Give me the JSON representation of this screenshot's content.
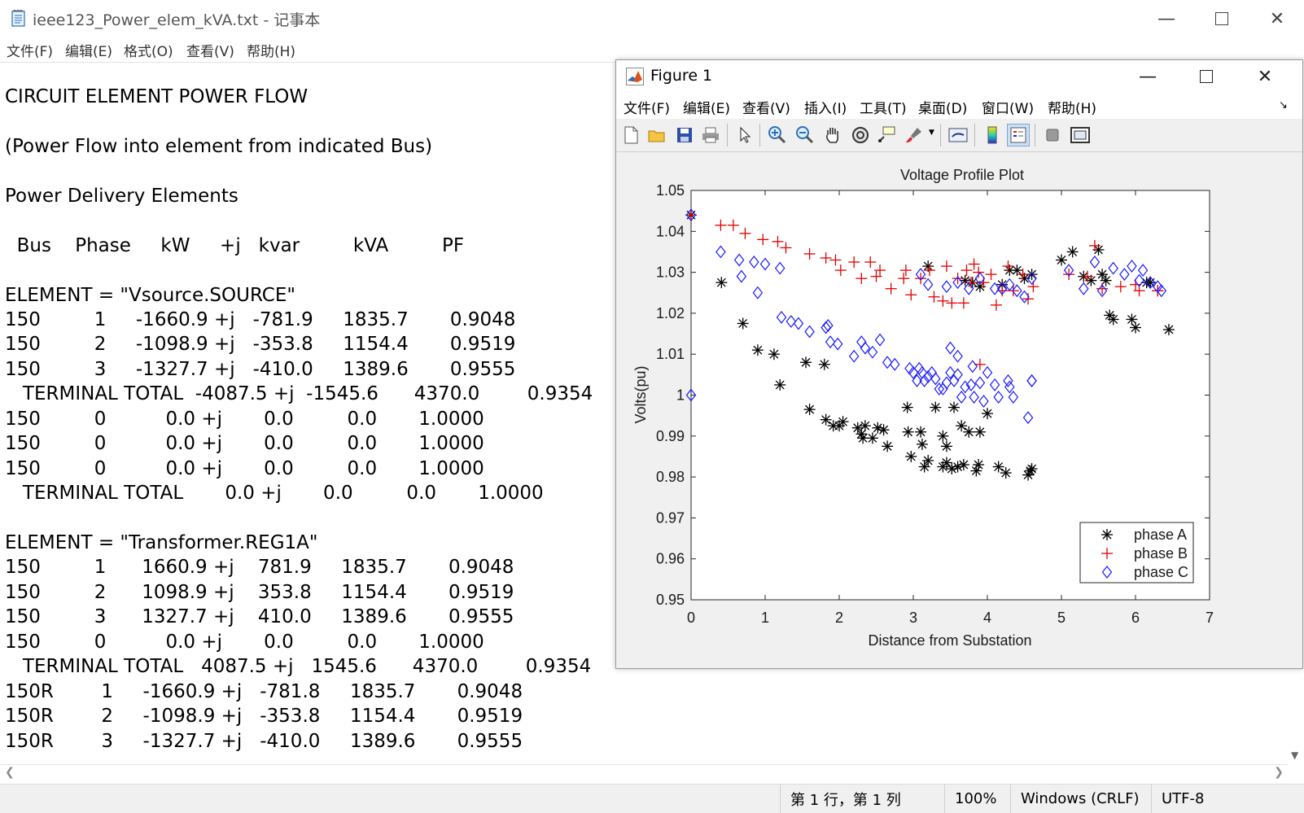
{
  "notepad": {
    "title": "ieee123_Power_elem_kVA.txt - 记事本",
    "menu": [
      "文件(F)",
      "编辑(E)",
      "格式(O)",
      "查看(V)",
      "帮助(H)"
    ],
    "lines": [
      "",
      "CIRCUIT ELEMENT POWER FLOW",
      "",
      "(Power Flow into element from indicated Bus)",
      "",
      "Power Delivery Elements",
      "",
      "  Bus    Phase     kW     +j   kvar         kVA         PF",
      "",
      "ELEMENT = \"Vsource.SOURCE\"",
      "150         1     -1660.9 +j   -781.9     1835.7       0.9048",
      "150         2     -1098.9 +j   -353.8     1154.4       0.9519",
      "150         3     -1327.7 +j   -410.0     1389.6       0.9555",
      "   TERMINAL TOTAL  -4087.5 +j  -1545.6      4370.0        0.9354",
      "150         0          0.0 +j       0.0         0.0       1.0000",
      "150         0          0.0 +j       0.0         0.0       1.0000",
      "150         0          0.0 +j       0.0         0.0       1.0000",
      "   TERMINAL TOTAL       0.0 +j       0.0         0.0       1.0000",
      "",
      "ELEMENT = \"Transformer.REG1A\"",
      "150         1      1660.9 +j    781.9     1835.7       0.9048",
      "150         2      1098.9 +j    353.8     1154.4       0.9519",
      "150         3      1327.7 +j    410.0     1389.6       0.9555",
      "150         0          0.0 +j       0.0         0.0       1.0000",
      "   TERMINAL TOTAL   4087.5 +j   1545.6      4370.0        0.9354",
      "150R        1     -1660.9 +j   -781.8     1835.7       0.9048",
      "150R        2     -1098.9 +j   -353.8     1154.4       0.9519",
      "150R        3     -1327.7 +j   -410.0     1389.6       0.9555"
    ],
    "status": {
      "position": "第 1 行，第 1 列",
      "zoom": "100%",
      "line_ending": "Windows (CRLF)",
      "encoding": "UTF-8"
    }
  },
  "figure": {
    "title": "Figure 1",
    "menu": [
      "文件(F)",
      "编辑(E)",
      "查看(V)",
      "插入(I)",
      "工具(T)",
      "桌面(D)",
      "窗口(W)",
      "帮助(H)"
    ],
    "toolbar_icons": [
      "new-figure-icon",
      "open-file-icon",
      "save-icon",
      "print-icon",
      "edit-plot-arrow-icon",
      "zoom-in-icon",
      "zoom-out-icon",
      "pan-hand-icon",
      "rotate-3d-icon",
      "data-cursor-icon",
      "brush-icon",
      "link-plot-icon",
      "colorbar-icon",
      "legend-icon",
      "hide-plot-tools-icon",
      "show-plot-tools-icon"
    ]
  },
  "chart_data": {
    "type": "scatter",
    "title": "Voltage Profile Plot",
    "xlabel": "Distance from Substation",
    "ylabel": "Volts(pu)",
    "xlim": [
      0,
      7
    ],
    "ylim": [
      0.95,
      1.05
    ],
    "xticks": [
      "0",
      "1",
      "2",
      "3",
      "4",
      "5",
      "6",
      "7"
    ],
    "yticks": [
      "0.95",
      "0.96",
      "0.97",
      "0.98",
      "0.99",
      "1",
      "1.01",
      "1.02",
      "1.03",
      "1.04",
      "1.05"
    ],
    "legend_position": "bottom-right",
    "series": [
      {
        "name": "phase A",
        "marker": "asterisk",
        "color": "#000000",
        "points": [
          [
            0,
            1.044
          ],
          [
            0.41,
            1.0275
          ],
          [
            0.7,
            1.0175
          ],
          [
            0.9,
            1.011
          ],
          [
            1.12,
            1.01
          ],
          [
            1.2,
            1.0025
          ],
          [
            1.55,
            1.008
          ],
          [
            1.6,
            0.9965
          ],
          [
            1.8,
            1.0075
          ],
          [
            1.82,
            0.994
          ],
          [
            1.92,
            0.9925
          ],
          [
            2.0,
            0.9925
          ],
          [
            2.05,
            0.9935
          ],
          [
            2.25,
            0.992
          ],
          [
            2.3,
            0.9905
          ],
          [
            2.32,
            0.9895
          ],
          [
            2.35,
            0.9925
          ],
          [
            2.45,
            0.9895
          ],
          [
            2.52,
            0.992
          ],
          [
            2.6,
            0.9915
          ],
          [
            2.65,
            0.9875
          ],
          [
            2.92,
            0.997
          ],
          [
            2.93,
            0.991
          ],
          [
            2.97,
            0.985
          ],
          [
            3.1,
            0.991
          ],
          [
            3.12,
            0.988
          ],
          [
            3.15,
            0.9825
          ],
          [
            3.2,
            0.984
          ],
          [
            3.2,
            1.0315
          ],
          [
            3.3,
            0.997
          ],
          [
            3.4,
            0.9825
          ],
          [
            3.4,
            0.99
          ],
          [
            3.45,
            0.9835
          ],
          [
            3.45,
            0.9875
          ],
          [
            3.52,
            0.982
          ],
          [
            3.55,
            0.997
          ],
          [
            3.6,
            0.9825
          ],
          [
            3.65,
            0.9925
          ],
          [
            3.68,
            0.983
          ],
          [
            3.7,
            1.028
          ],
          [
            3.75,
            0.991
          ],
          [
            3.85,
            0.9815
          ],
          [
            3.88,
            0.983
          ],
          [
            3.9,
            0.991
          ],
          [
            4.0,
            0.9955
          ],
          [
            4.15,
            0.9825
          ],
          [
            4.25,
            0.981
          ],
          [
            4.55,
            0.9805
          ],
          [
            4.58,
            0.9815
          ],
          [
            4.6,
            0.982
          ],
          [
            3.8,
            1.0275
          ],
          [
            3.9,
            1.0265
          ],
          [
            4.2,
            1.027
          ],
          [
            4.3,
            1.0305
          ],
          [
            4.4,
            1.0305
          ],
          [
            4.5,
            1.0285
          ],
          [
            4.6,
            1.0295
          ],
          [
            5.0,
            1.033
          ],
          [
            5.15,
            1.035
          ],
          [
            5.3,
            1.029
          ],
          [
            5.4,
            1.028
          ],
          [
            5.5,
            1.0355
          ],
          [
            5.55,
            1.0295
          ],
          [
            5.6,
            1.028
          ],
          [
            5.65,
            1.0195
          ],
          [
            5.7,
            1.0185
          ],
          [
            5.95,
            1.0185
          ],
          [
            6.0,
            1.0165
          ],
          [
            6.15,
            1.0275
          ],
          [
            6.2,
            1.0275
          ],
          [
            6.45,
            1.016
          ]
        ]
      },
      {
        "name": "phase B",
        "marker": "plus",
        "color": "#e00000",
        "points": [
          [
            0,
            1.044
          ],
          [
            0.4,
            1.0415
          ],
          [
            0.57,
            1.0415
          ],
          [
            0.73,
            1.0395
          ],
          [
            0.97,
            1.038
          ],
          [
            1.17,
            1.0375
          ],
          [
            1.28,
            1.036
          ],
          [
            1.6,
            1.0345
          ],
          [
            1.82,
            1.0335
          ],
          [
            1.95,
            1.033
          ],
          [
            2.02,
            1.0305
          ],
          [
            2.2,
            1.0325
          ],
          [
            2.3,
            1.0285
          ],
          [
            2.42,
            1.0325
          ],
          [
            2.5,
            1.029
          ],
          [
            2.55,
            1.0305
          ],
          [
            2.7,
            1.026
          ],
          [
            2.87,
            1.0285
          ],
          [
            2.9,
            1.0305
          ],
          [
            2.97,
            1.0245
          ],
          [
            3.1,
            1.0285
          ],
          [
            3.22,
            1.0305
          ],
          [
            3.28,
            1.024
          ],
          [
            3.4,
            1.023
          ],
          [
            3.45,
            1.0315
          ],
          [
            3.52,
            1.0225
          ],
          [
            3.6,
            1.0285
          ],
          [
            3.68,
            1.0225
          ],
          [
            3.72,
            1.0305
          ],
          [
            3.78,
            1.0275
          ],
          [
            3.82,
            1.032
          ],
          [
            3.88,
            1.03
          ],
          [
            3.95,
            1.0275
          ],
          [
            4.05,
            1.0295
          ],
          [
            4.12,
            1.022
          ],
          [
            4.2,
            1.0255
          ],
          [
            4.28,
            1.0315
          ],
          [
            4.35,
            1.0255
          ],
          [
            4.48,
            1.0295
          ],
          [
            4.55,
            1.0235
          ],
          [
            4.62,
            1.0265
          ],
          [
            5.1,
            1.0295
          ],
          [
            5.35,
            1.029
          ],
          [
            5.45,
            1.0365
          ],
          [
            5.55,
            1.026
          ],
          [
            5.8,
            1.0265
          ],
          [
            6.0,
            1.027
          ],
          [
            6.05,
            1.0255
          ],
          [
            6.3,
            1.0255
          ],
          [
            6.3,
            1.0255
          ],
          [
            3.9,
            1.0075
          ]
        ]
      },
      {
        "name": "phase C",
        "marker": "diamond",
        "color": "#1a1aff",
        "points": [
          [
            0,
            1.044
          ],
          [
            0,
            1.0
          ],
          [
            0.4,
            1.035
          ],
          [
            0.65,
            1.033
          ],
          [
            0.68,
            1.029
          ],
          [
            0.85,
            1.0325
          ],
          [
            0.9,
            1.025
          ],
          [
            1.0,
            1.032
          ],
          [
            1.2,
            1.031
          ],
          [
            1.22,
            1.019
          ],
          [
            1.35,
            1.018
          ],
          [
            1.45,
            1.0175
          ],
          [
            1.6,
            1.0155
          ],
          [
            1.82,
            1.0165
          ],
          [
            1.85,
            1.017
          ],
          [
            1.88,
            1.013
          ],
          [
            1.98,
            1.0125
          ],
          [
            2.2,
            1.0095
          ],
          [
            2.3,
            1.013
          ],
          [
            2.35,
            1.0115
          ],
          [
            2.45,
            1.0105
          ],
          [
            2.55,
            1.0135
          ],
          [
            2.65,
            1.008
          ],
          [
            2.75,
            1.0075
          ],
          [
            2.95,
            1.0065
          ],
          [
            3.0,
            1.0055
          ],
          [
            3.05,
            1.0035
          ],
          [
            3.08,
            1.0065
          ],
          [
            3.12,
            1.0055
          ],
          [
            3.15,
            1.0035
          ],
          [
            3.2,
            1.0045
          ],
          [
            3.25,
            1.0055
          ],
          [
            3.3,
            1.004
          ],
          [
            3.35,
            1.0015
          ],
          [
            3.4,
            1.0015
          ],
          [
            3.45,
            1.003
          ],
          [
            3.5,
            1.0055
          ],
          [
            3.55,
            1.0035
          ],
          [
            3.6,
            1.005
          ],
          [
            3.65,
            0.9995
          ],
          [
            3.7,
            1.002
          ],
          [
            3.78,
            1.0025
          ],
          [
            3.82,
            0.9995
          ],
          [
            3.9,
            1.003
          ],
          [
            3.95,
            0.9985
          ],
          [
            4.0,
            1.0055
          ],
          [
            4.1,
            1.0025
          ],
          [
            4.15,
            0.9995
          ],
          [
            4.28,
            1.0035
          ],
          [
            4.35,
            0.9995
          ],
          [
            4.55,
            0.9945
          ],
          [
            4.6,
            1.0035
          ],
          [
            4.6,
            1.0035
          ],
          [
            3.1,
            1.0295
          ],
          [
            3.2,
            1.027
          ],
          [
            3.45,
            1.0265
          ],
          [
            3.6,
            1.0275
          ],
          [
            3.75,
            1.026
          ],
          [
            3.9,
            1.0285
          ],
          [
            4.1,
            1.026
          ],
          [
            4.2,
            1.026
          ],
          [
            4.3,
            1.027
          ],
          [
            4.4,
            1.0255
          ],
          [
            4.5,
            1.024
          ],
          [
            4.6,
            1.0285
          ],
          [
            5.1,
            1.0305
          ],
          [
            5.3,
            1.026
          ],
          [
            5.45,
            1.0325
          ],
          [
            5.55,
            1.0255
          ],
          [
            5.7,
            1.031
          ],
          [
            5.85,
            1.0295
          ],
          [
            5.95,
            1.0315
          ],
          [
            6.05,
            1.028
          ],
          [
            6.1,
            1.0305
          ],
          [
            6.2,
            1.0275
          ],
          [
            6.3,
            1.0265
          ],
          [
            6.35,
            1.0255
          ],
          [
            3.5,
            1.0115
          ],
          [
            3.6,
            1.0095
          ],
          [
            3.8,
            1.007
          ],
          [
            4.3,
            1.002
          ]
        ]
      }
    ]
  }
}
